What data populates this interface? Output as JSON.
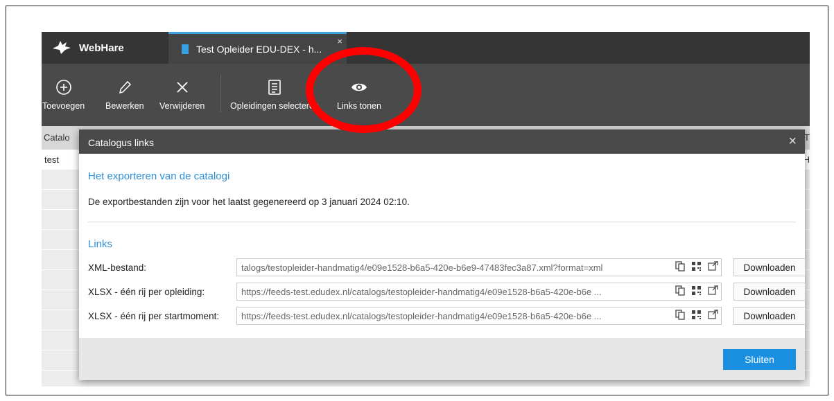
{
  "app": {
    "brand": "WebHare",
    "tab_title": "Test Opleider EDU-DEX - h...",
    "tab_close": "×"
  },
  "toolbar": {
    "add": "Toevoegen",
    "edit": "Bewerken",
    "delete": "Verwijderen",
    "select": "Opleidingen selecteren",
    "links": "Links tonen"
  },
  "grid": {
    "header": "Catalo",
    "first_cell": "test",
    "right_header_fragment": "T",
    "right_cell_fragment": "H"
  },
  "dialog": {
    "title": "Catalogus links",
    "close": "×",
    "export_heading": "Het exporteren van de catalogi",
    "export_text": "De exportbestanden zijn voor het laatst gegenereerd op 3 januari 2024 02:10.",
    "links_heading": "Links",
    "links": [
      {
        "label": "XML-bestand:",
        "url": "talogs/testopleider-handmatig4/e09e1528-b6a5-420e-b6e9-47483fec3a87.xml?format=xml",
        "button": "Downloaden"
      },
      {
        "label": "XLSX - één rij per opleiding:",
        "url": "https://feeds-test.edudex.nl/catalogs/testopleider-handmatig4/e09e1528-b6a5-420e-b6e ...",
        "button": "Downloaden"
      },
      {
        "label": "XLSX - één rij per startmoment:",
        "url": "https://feeds-test.edudex.nl/catalogs/testopleider-handmatig4/e09e1528-b6a5-420e-b6e ...",
        "button": "Downloaden"
      }
    ],
    "close_button": "Sluiten"
  },
  "colors": {
    "accent": "#1b8fe0",
    "heading": "#2e8ed6",
    "toolbar": "#4a4a4a",
    "topbar": "#353535",
    "highlight": "#ff0000"
  },
  "icons": [
    "rabbit-logo-icon",
    "document-icon",
    "plus-circle-icon",
    "pencil-icon",
    "x-icon",
    "checklist-icon",
    "eye-icon",
    "copy-icon",
    "qr-code-icon",
    "external-link-icon",
    "close-icon"
  ]
}
